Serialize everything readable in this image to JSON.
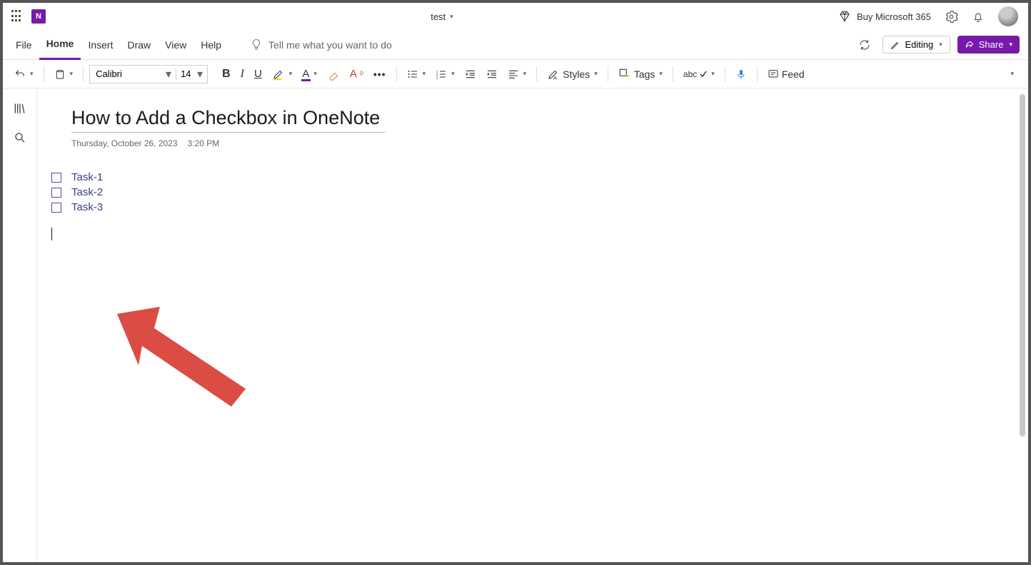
{
  "titlebar": {
    "notebook_name": "test",
    "buy_label": "Buy Microsoft 365"
  },
  "menubar": {
    "items": [
      "File",
      "Home",
      "Insert",
      "Draw",
      "View",
      "Help"
    ],
    "active_index": 1,
    "tell_me_placeholder": "Tell me what you want to do",
    "editing_label": "Editing",
    "share_label": "Share"
  },
  "toolbar": {
    "font_name": "Calibri",
    "font_size": "14",
    "styles_label": "Styles",
    "tags_label": "Tags",
    "feed_label": "Feed"
  },
  "page": {
    "title": "How to Add a Checkbox in OneNote",
    "date": "Thursday, October 26, 2023",
    "time": "3:20 PM",
    "tasks": [
      "Task-1",
      "Task-2",
      "Task-3"
    ]
  },
  "colors": {
    "accent": "#7719aa",
    "highlight_yellow": "#ffd800",
    "font_color_underline": "#7719aa",
    "arrow": "#db4c45"
  }
}
